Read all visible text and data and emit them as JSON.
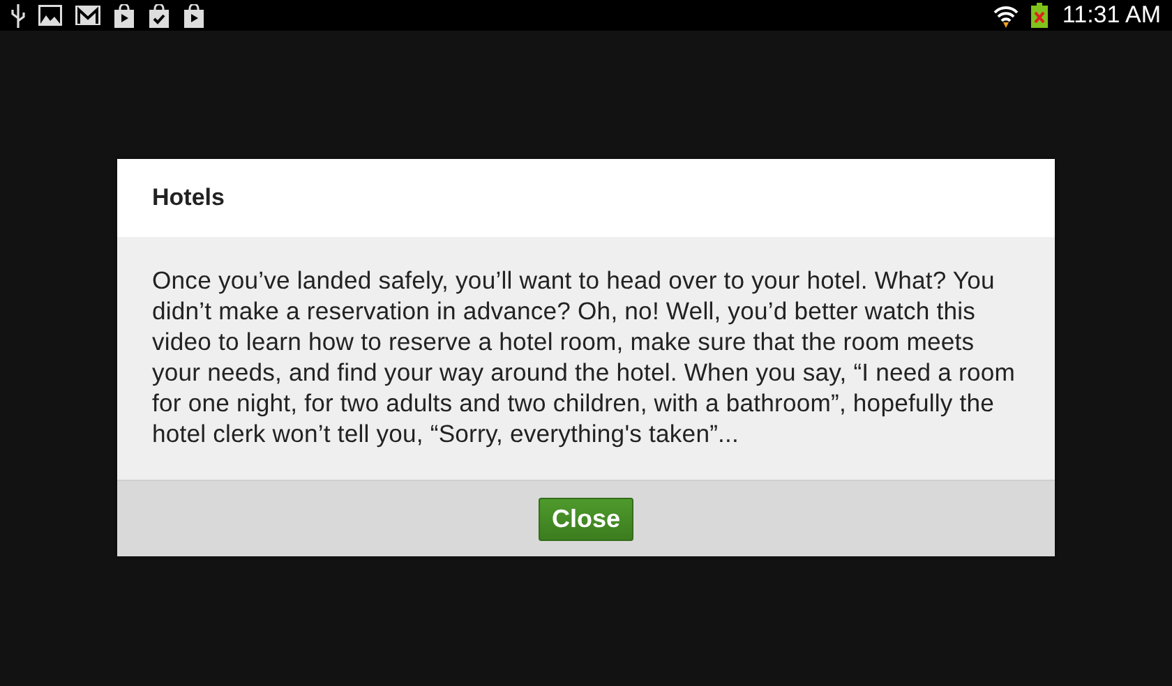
{
  "status_bar": {
    "time": "11:31 AM"
  },
  "dialog": {
    "title": "Hotels",
    "message": "Once you’ve landed safely, you’ll want to head over to your hotel. What? You didn’t make a reservation in advance? Oh, no! Well, you’d better watch this video to learn how to reserve a hotel room, make sure that the room meets your needs, and find your way around the hotel. When you say, “I need a room for one night, for two adults and two children, with a bathroom”, hopefully the hotel clerk won’t tell you, “Sorry, everything's taken”...",
    "buttons": [
      "Close"
    ]
  }
}
